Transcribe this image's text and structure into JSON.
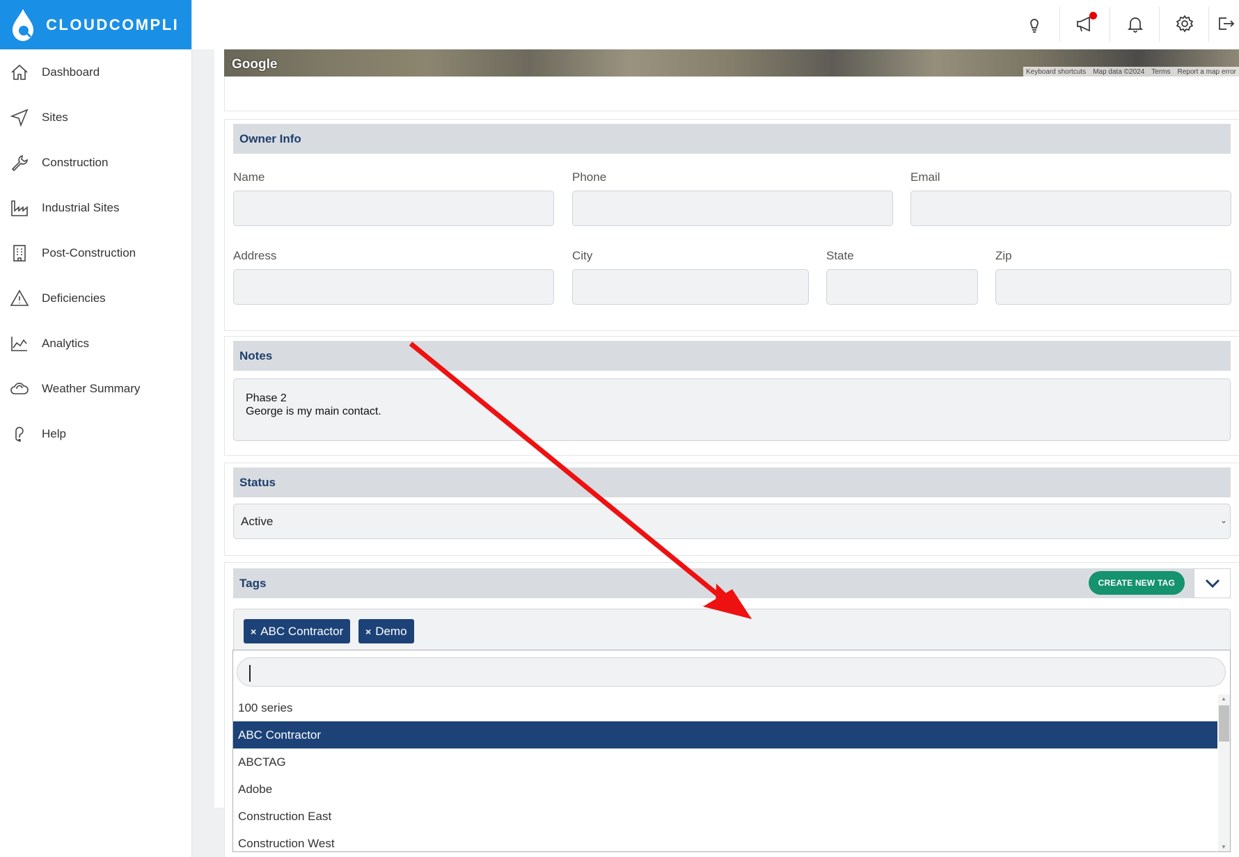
{
  "brand": {
    "name": "CLOUDCOMPLI"
  },
  "sidebar": {
    "items": [
      {
        "label": "Dashboard",
        "icon": "home-icon"
      },
      {
        "label": "Sites",
        "icon": "navigation-icon"
      },
      {
        "label": "Construction",
        "icon": "wrench-icon"
      },
      {
        "label": "Industrial Sites",
        "icon": "factory-icon"
      },
      {
        "label": "Post-Construction",
        "icon": "building-icon"
      },
      {
        "label": "Deficiencies",
        "icon": "warning-icon"
      },
      {
        "label": "Analytics",
        "icon": "chart-icon"
      },
      {
        "label": "Weather Summary",
        "icon": "cloud-icon"
      },
      {
        "label": "Help",
        "icon": "help-icon"
      }
    ]
  },
  "topbar": {
    "icons": [
      "lightbulb-icon",
      "megaphone-icon",
      "bell-icon",
      "gear-icon",
      "logout-icon"
    ],
    "notification_dot_color": "#e60000"
  },
  "map": {
    "logo": "Google",
    "attribution": [
      "Keyboard shortcuts",
      "Map data ©2024",
      "Terms",
      "Report a map error"
    ]
  },
  "owner_info": {
    "title": "Owner Info",
    "name_label": "Name",
    "phone_label": "Phone",
    "email_label": "Email",
    "address_label": "Address",
    "city_label": "City",
    "state_label": "State",
    "zip_label": "Zip"
  },
  "notes": {
    "title": "Notes",
    "line1": "Phase 2",
    "line2": "George is my main contact."
  },
  "status": {
    "title": "Status",
    "value": "Active"
  },
  "tags": {
    "title": "Tags",
    "create_label": "CREATE NEW TAG",
    "selected": [
      "ABC Contractor",
      "Demo"
    ],
    "search_value": "",
    "options": [
      "100 series",
      "ABC Contractor",
      "ABCTAG",
      "Adobe",
      "Construction East",
      "Construction West"
    ],
    "highlighted": "ABC Contractor"
  },
  "colors": {
    "brand_blue": "#1a8fe6",
    "header_navy": "#1f3f6b",
    "tag_navy": "#1c4278",
    "create_green": "#15926e",
    "arrow_red": "#ee1111"
  }
}
